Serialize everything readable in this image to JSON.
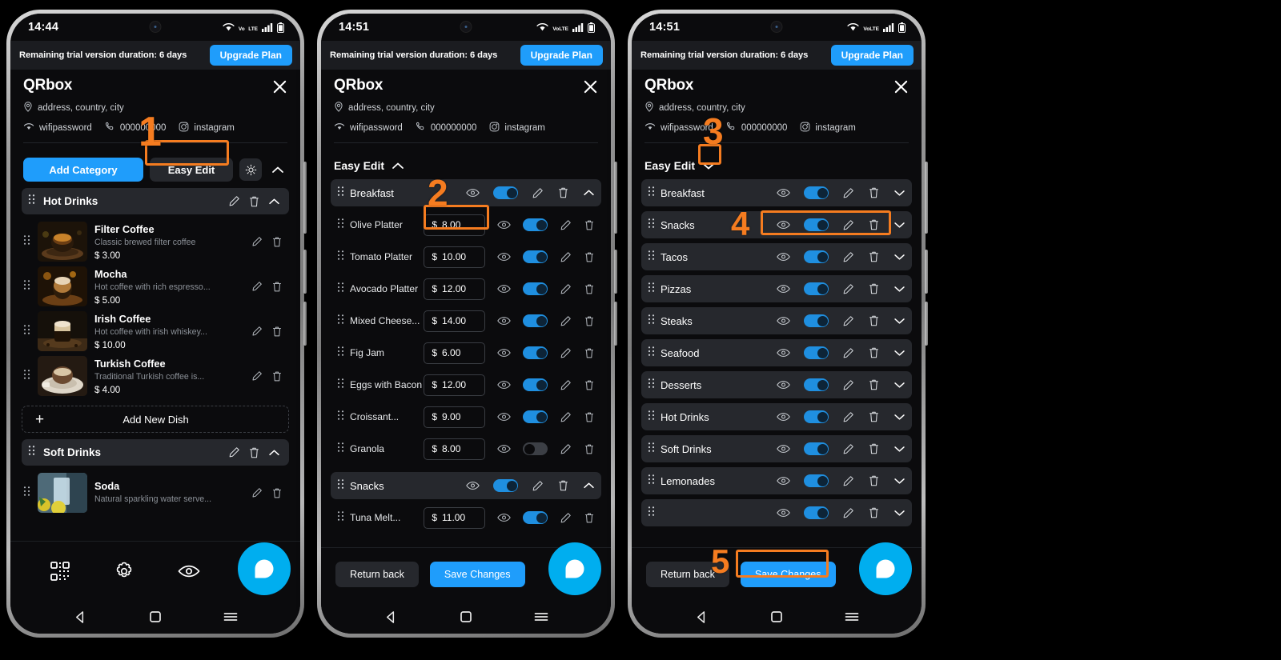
{
  "accent": {
    "blue": "#1f9dfb",
    "toggle_blue": "#1f8fe0",
    "annotation_orange": "#f57c20",
    "fab_blue": "#00aeef",
    "panel_gray": "#26282d"
  },
  "phones": [
    {
      "id": "phone-1",
      "status": {
        "time": "14:44",
        "icons": [
          "wifi-icon",
          "volte-icon",
          "signal-icon",
          "battery-icon"
        ],
        "volte_top": "Vo",
        "volte_bottom": "LTE"
      },
      "trial": {
        "text": "Remaining trial version duration: 6 days",
        "upgrade_label": "Upgrade Plan"
      },
      "brand": {
        "name": "QRbox",
        "close_icon": "close-icon"
      },
      "meta": {
        "address": "address, country, city",
        "wifi": "wifipassword",
        "phone": "000000000",
        "instagram": "instagram"
      },
      "actions": {
        "add_category": "Add Category",
        "easy_edit": "Easy Edit",
        "theme_icon": "sun-icon",
        "collapse_icon": "chevron-up-icon"
      },
      "categories": [
        {
          "name": "Hot Drinks",
          "collapsed": false,
          "dishes": [
            {
              "name": "Filter Coffee",
              "desc": "Classic brewed filter coffee",
              "price": "$ 3.00"
            },
            {
              "name": "Mocha",
              "desc": "Hot coffee with rich espresso...",
              "price": "$ 5.00"
            },
            {
              "name": "Irish Coffee",
              "desc": "Hot coffee with irish whiskey...",
              "price": "$ 10.00"
            },
            {
              "name": "Turkish Coffee",
              "desc": "Traditional Turkish coffee is...",
              "price": "$ 4.00"
            }
          ],
          "add_dish_label": "Add New Dish"
        },
        {
          "name": "Soft Drinks",
          "collapsed": false,
          "dishes": [
            {
              "name": "Soda",
              "desc": "Natural sparkling water serve...",
              "price": ""
            }
          ]
        }
      ],
      "toolbar": [
        "qr-code-icon",
        "gear-icon",
        "eye-icon",
        "upload-icon"
      ],
      "fab": "chat-bubble-icon",
      "nav": [
        "back-triangle-icon",
        "home-square-icon",
        "recents-menu-icon"
      ]
    },
    {
      "id": "phone-2",
      "status": {
        "time": "14:51"
      },
      "easy_edit": {
        "label": "Easy Edit",
        "chevron": "chevron-up-icon"
      },
      "rows": [
        {
          "type": "category",
          "name": "Breakfast",
          "toggle": true,
          "chevron": "chevron-up-icon"
        },
        {
          "type": "item",
          "name": "Olive Platter",
          "price": "8.00",
          "toggle": true
        },
        {
          "type": "item",
          "name": "Tomato Platter",
          "price": "10.00",
          "toggle": true
        },
        {
          "type": "item",
          "name": "Avocado Platter",
          "price": "12.00",
          "toggle": true
        },
        {
          "type": "item",
          "name": "Mixed Cheese...",
          "price": "14.00",
          "toggle": true
        },
        {
          "type": "item",
          "name": "Fig Jam",
          "price": "6.00",
          "toggle": true
        },
        {
          "type": "item",
          "name": "Eggs with Bacon",
          "price": "12.00",
          "toggle": true
        },
        {
          "type": "item",
          "name": "Croissant...",
          "price": "9.00",
          "toggle": true
        },
        {
          "type": "item",
          "name": "Granola",
          "price": "8.00",
          "toggle": false
        },
        {
          "type": "category",
          "name": "Snacks",
          "toggle": true,
          "chevron": "chevron-up-icon"
        },
        {
          "type": "item",
          "name": "Tuna Melt...",
          "price": "11.00",
          "toggle": true
        }
      ],
      "currency": "$",
      "bottom": {
        "return": "Return back",
        "save": "Save Changes"
      }
    },
    {
      "id": "phone-3",
      "status": {
        "time": "14:51"
      },
      "easy_edit": {
        "label": "Easy Edit",
        "chevron": "chevron-down-icon"
      },
      "categories": [
        {
          "name": "Breakfast",
          "toggle": true
        },
        {
          "name": "Snacks",
          "toggle": true
        },
        {
          "name": "Tacos",
          "toggle": true
        },
        {
          "name": "Pizzas",
          "toggle": true
        },
        {
          "name": "Steaks",
          "toggle": true
        },
        {
          "name": "Seafood",
          "toggle": true
        },
        {
          "name": "Desserts",
          "toggle": true
        },
        {
          "name": "Hot Drinks",
          "toggle": true
        },
        {
          "name": "Soft Drinks",
          "toggle": true
        },
        {
          "name": "Lemonades",
          "toggle": true
        }
      ],
      "bottom": {
        "return": "Return back",
        "save": "Save Changes"
      }
    }
  ],
  "annotations": [
    {
      "id": "1",
      "label": "1",
      "target": "easy-edit-button"
    },
    {
      "id": "2",
      "label": "2",
      "target": "olive-platter-price"
    },
    {
      "id": "3",
      "label": "3",
      "target": "easy-edit-chevron"
    },
    {
      "id": "4",
      "label": "4",
      "target": "snacks-row-controls"
    },
    {
      "id": "5",
      "label": "5",
      "target": "save-changes-button"
    }
  ]
}
